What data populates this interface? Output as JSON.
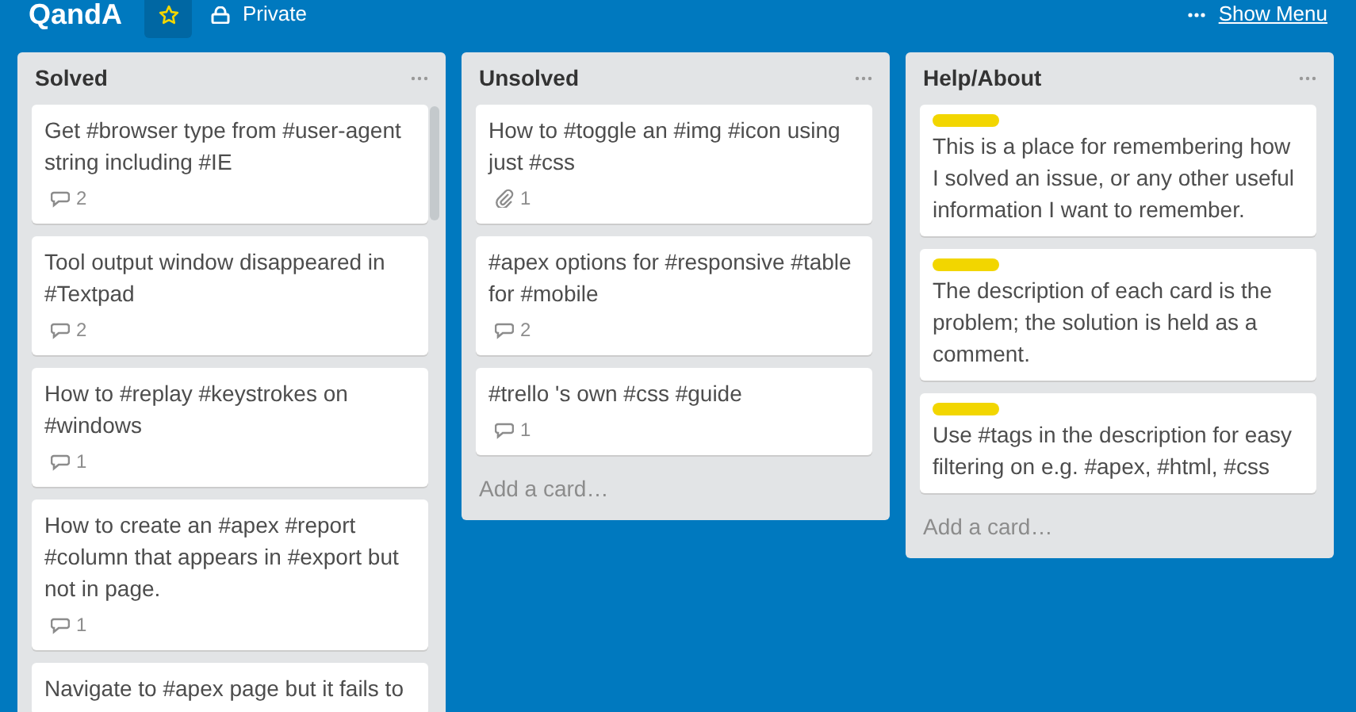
{
  "board": {
    "title": "QandA",
    "starred": true,
    "visibility": "Private",
    "menu_label": "Show Menu"
  },
  "lists": [
    {
      "title": "Solved",
      "cards": [
        {
          "text": "Get #browser type from #user-agent string including #IE",
          "badges": [
            {
              "kind": "comments",
              "count": "2"
            }
          ]
        },
        {
          "text": "Tool output window disappeared in #Textpad",
          "badges": [
            {
              "kind": "comments",
              "count": "2"
            }
          ]
        },
        {
          "text": "How to #replay #keystrokes on #windows",
          "badges": [
            {
              "kind": "comments",
              "count": "1"
            }
          ]
        },
        {
          "text": "How to create an #apex #report #column that appears in #export but not in page.",
          "badges": [
            {
              "kind": "comments",
              "count": "1"
            }
          ]
        },
        {
          "text": "Navigate to #apex page but it fails to"
        }
      ]
    },
    {
      "title": "Unsolved",
      "add_card": "Add a card…",
      "cards": [
        {
          "text": "How to #toggle an #img #icon using just #css",
          "badges": [
            {
              "kind": "attachments",
              "count": "1"
            }
          ]
        },
        {
          "text": "#apex options for #responsive #table for #mobile",
          "badges": [
            {
              "kind": "comments",
              "count": "2"
            }
          ]
        },
        {
          "text": "#trello 's own #css #guide",
          "badges": [
            {
              "kind": "comments",
              "count": "1"
            }
          ]
        }
      ]
    },
    {
      "title": "Help/About",
      "add_card": "Add a card…",
      "cards": [
        {
          "labels": [
            {
              "color": "#f2d600"
            }
          ],
          "text": "This is a place for remembering how I solved an issue, or any other useful information I want to remember."
        },
        {
          "labels": [
            {
              "color": "#f2d600"
            }
          ],
          "text": "The description of each card is the problem; the solution is held as a comment."
        },
        {
          "labels": [
            {
              "color": "#f2d600"
            }
          ],
          "text": "Use #tags in the description for easy filtering on e.g. #apex, #html, #css"
        }
      ]
    }
  ]
}
